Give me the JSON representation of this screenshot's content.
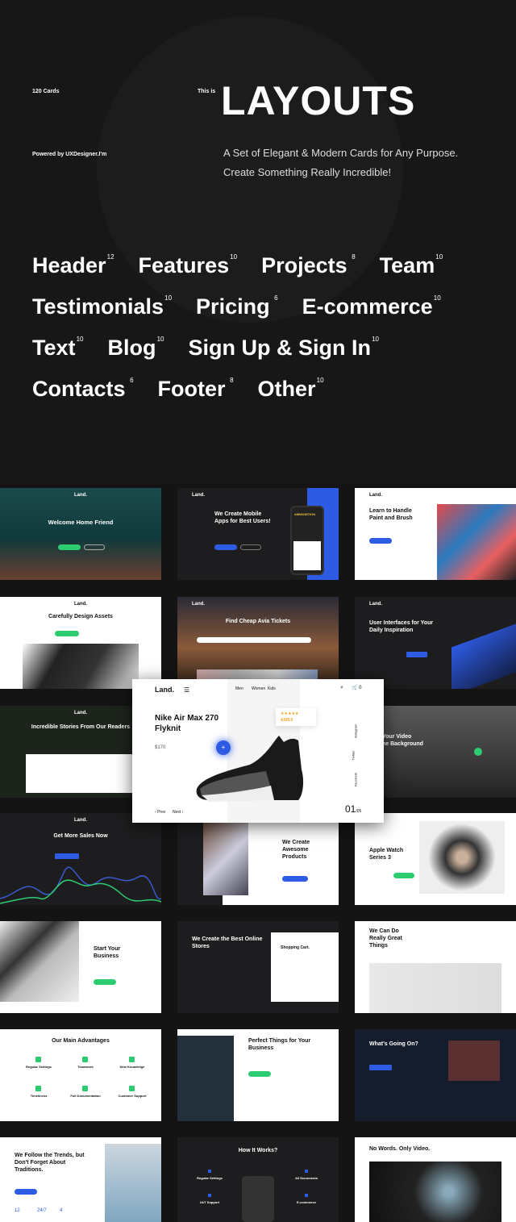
{
  "hero": {
    "count": "120 Cards",
    "powered": "Powered by UXDesigner.I'm",
    "this_is": "This is",
    "title": "LAYOUTS",
    "tagline1": "A Set of Elegant & Modern Cards for Any Purpose.",
    "tagline2": "Create Something Really Incredible!"
  },
  "categories": [
    [
      {
        "name": "Header",
        "count": "12"
      },
      {
        "name": "Features",
        "count": "10"
      },
      {
        "name": "Projects",
        "count": "8"
      },
      {
        "name": "Team",
        "count": "10"
      }
    ],
    [
      {
        "name": "Testimonials",
        "count": "10"
      },
      {
        "name": "Pricing",
        "count": "6"
      },
      {
        "name": "E-commerce",
        "count": "10"
      }
    ],
    [
      {
        "name": "Text",
        "count": "10"
      },
      {
        "name": "Blog",
        "count": "10"
      },
      {
        "name": "Sign Up & Sign In",
        "count": "10"
      }
    ],
    [
      {
        "name": "Contacts",
        "count": "6"
      },
      {
        "name": "Footer",
        "count": "8"
      },
      {
        "name": "Other",
        "count": "10"
      }
    ]
  ],
  "logo": "Land.",
  "cards": {
    "c0": "Welcome Home Friend",
    "c1": "We Create Mobile Apps for Best Users!",
    "c1b": "AMMUNITION",
    "c2": "Learn to Handle Paint and Brush",
    "c3": "Carefully Design Assets",
    "c4": "Find Cheap Avia Tickets",
    "c5": "User Interfaces for Your Daily Inspiration",
    "c6": "Incredible Stories From Our Readers",
    "c8a": "Your Video",
    "c8b": "he Background",
    "c9": "Get More Sales Now",
    "c10": "We Create Awesome Products",
    "c11": "Apple Watch Series 3",
    "c12": "Start Your Business",
    "c13": "We Create the Best Online Stores",
    "c13b": "Shopping Cart.",
    "c14": "We Can Do Really Great Things",
    "c15": "Our Main Advantages",
    "c15f": [
      "Regular Settings",
      "Teamwork",
      "New Knowledge",
      "Timeliness",
      "Full Documentation",
      "Customer Support"
    ],
    "c16": "Perfect Things for Your Business",
    "c17": "What's Going On?",
    "c18": "We Follow the Trends, but Don't Forget About Traditions.",
    "c18s": [
      "12",
      "24/7",
      "4"
    ],
    "c19": "How It Works?",
    "c19f": [
      "Regular Settings",
      "All Documents",
      "24/7 Support",
      "E-commerce"
    ],
    "c20": "No Words. Only Video."
  },
  "featured": {
    "nav": [
      "Men",
      "Women",
      "Kids"
    ],
    "cart_count": "0",
    "title": "Nike Air Max 270 Flyknit",
    "price": "$170",
    "rating": "4.6/5.0",
    "stars": 5,
    "prev": "Prev",
    "next": "Next",
    "page": "01",
    "total": "/05",
    "social": [
      "Instagram",
      "Twitter",
      "Facebook"
    ]
  },
  "colors": {
    "accent_blue": "#2d5be3",
    "accent_green": "#2ecc71",
    "bg": "#141414"
  }
}
